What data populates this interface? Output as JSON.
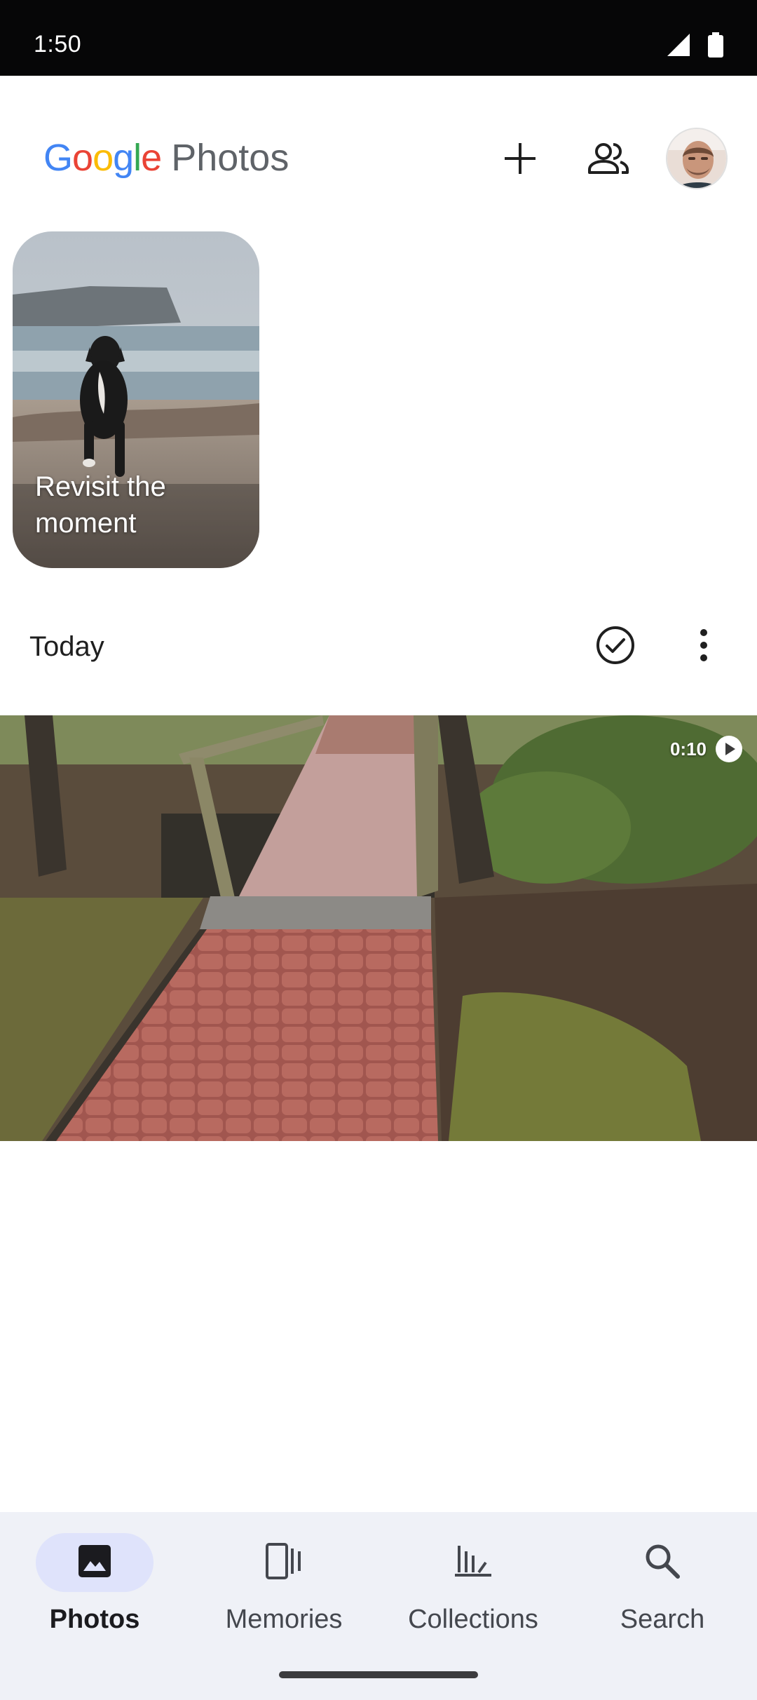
{
  "status_bar": {
    "time": "1:50",
    "icons": [
      "cellular-signal-icon",
      "battery-icon"
    ]
  },
  "app_bar": {
    "logo_google": [
      "G",
      "o",
      "o",
      "g",
      "l",
      "e"
    ],
    "logo_photos": "Photos",
    "actions": [
      "add-icon",
      "sharing-icon",
      "account-avatar"
    ]
  },
  "memory_card": {
    "label": "Revisit the moment"
  },
  "section": {
    "title": "Today",
    "actions": [
      "select-check-icon",
      "more-vert-icon"
    ]
  },
  "video": {
    "duration": "0:10"
  },
  "bottom_nav": {
    "items": [
      {
        "label": "Photos",
        "icon": "photo-icon",
        "active": true
      },
      {
        "label": "Memories",
        "icon": "memories-icon",
        "active": false
      },
      {
        "label": "Collections",
        "icon": "collections-icon",
        "active": false
      },
      {
        "label": "Search",
        "icon": "search-icon",
        "active": false
      }
    ]
  },
  "colors": {
    "accent_pill": "#dfe3fb",
    "nav_background": "#eff1f7",
    "status_bar": "#060607"
  }
}
